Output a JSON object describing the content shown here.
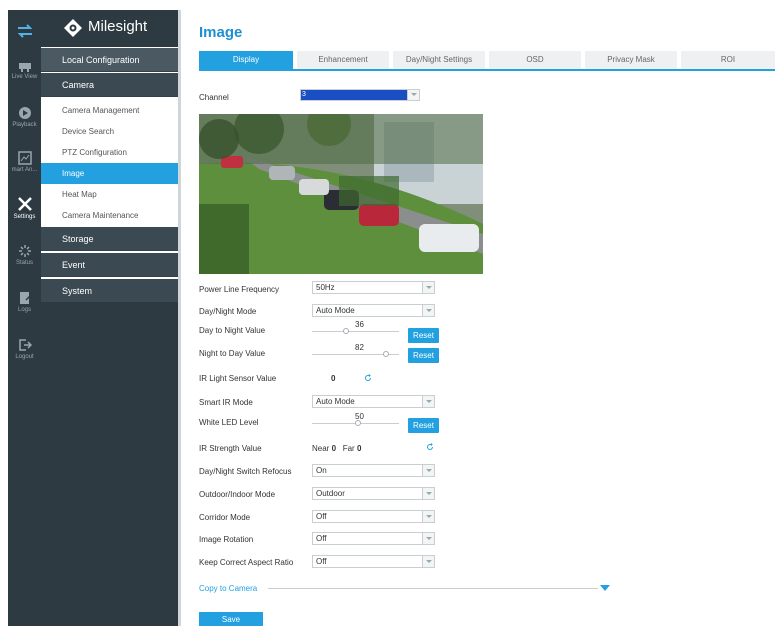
{
  "rail": {
    "items": [
      {
        "label": "",
        "icon": "swap-icon"
      },
      {
        "label": "Live View",
        "icon": "live-view-icon"
      },
      {
        "label": "Playback",
        "icon": "playback-icon"
      },
      {
        "label": "mart An...",
        "icon": "smart-analytics-icon"
      },
      {
        "label": "Settings",
        "icon": "settings-icon"
      },
      {
        "label": "Status",
        "icon": "status-icon"
      },
      {
        "label": "Logs",
        "icon": "logs-icon"
      },
      {
        "label": "Logout",
        "icon": "logout-icon"
      }
    ]
  },
  "brand": {
    "name": "Milesight"
  },
  "sidebar": {
    "local_configuration": "Local Configuration",
    "camera": "Camera",
    "camera_items": [
      "Camera Management",
      "Device Search",
      "PTZ Configuration",
      "Image",
      "Heat Map",
      "Camera Maintenance"
    ],
    "storage": "Storage",
    "event": "Event",
    "system": "System"
  },
  "page": {
    "title": "Image"
  },
  "tabs": [
    "Display",
    "Enhancement",
    "Day/Night Settings",
    "OSD",
    "Privacy Mask",
    "ROI"
  ],
  "form": {
    "channel_label": "Channel",
    "channel_value": "3",
    "power_line_label": "Power Line Frequency",
    "power_line_value": "50Hz",
    "day_night_mode_label": "Day/Night Mode",
    "day_night_mode_value": "Auto Mode",
    "day_to_night_label": "Day to Night Value",
    "day_to_night_value": "36",
    "night_to_day_label": "Night to Day Value",
    "night_to_day_value": "82",
    "reset_label": "Reset",
    "ir_sensor_label": "IR Light Sensor Value",
    "ir_sensor_value": "0",
    "smart_ir_label": "Smart IR Mode",
    "smart_ir_value": "Auto Mode",
    "white_led_label": "White LED Level",
    "white_led_value": "50",
    "ir_strength_label": "IR Strength Value",
    "ir_near_label": "Near",
    "ir_near_value": "0",
    "ir_far_label": "Far",
    "ir_far_value": "0",
    "refocus_label": "Day/Night Switch Refocus",
    "refocus_value": "On",
    "outdoor_label": "Outdoor/Indoor Mode",
    "outdoor_value": "Outdoor",
    "corridor_label": "Corridor Mode",
    "corridor_value": "Off",
    "rotation_label": "Image Rotation",
    "rotation_value": "Off",
    "aspect_label": "Keep Correct Aspect Ratio",
    "aspect_value": "Off",
    "copy_label": "Copy to Camera",
    "save_label": "Save"
  },
  "colors": {
    "accent": "#22a0e0",
    "rail": "#2d3a41",
    "section": "#3b4a52"
  }
}
